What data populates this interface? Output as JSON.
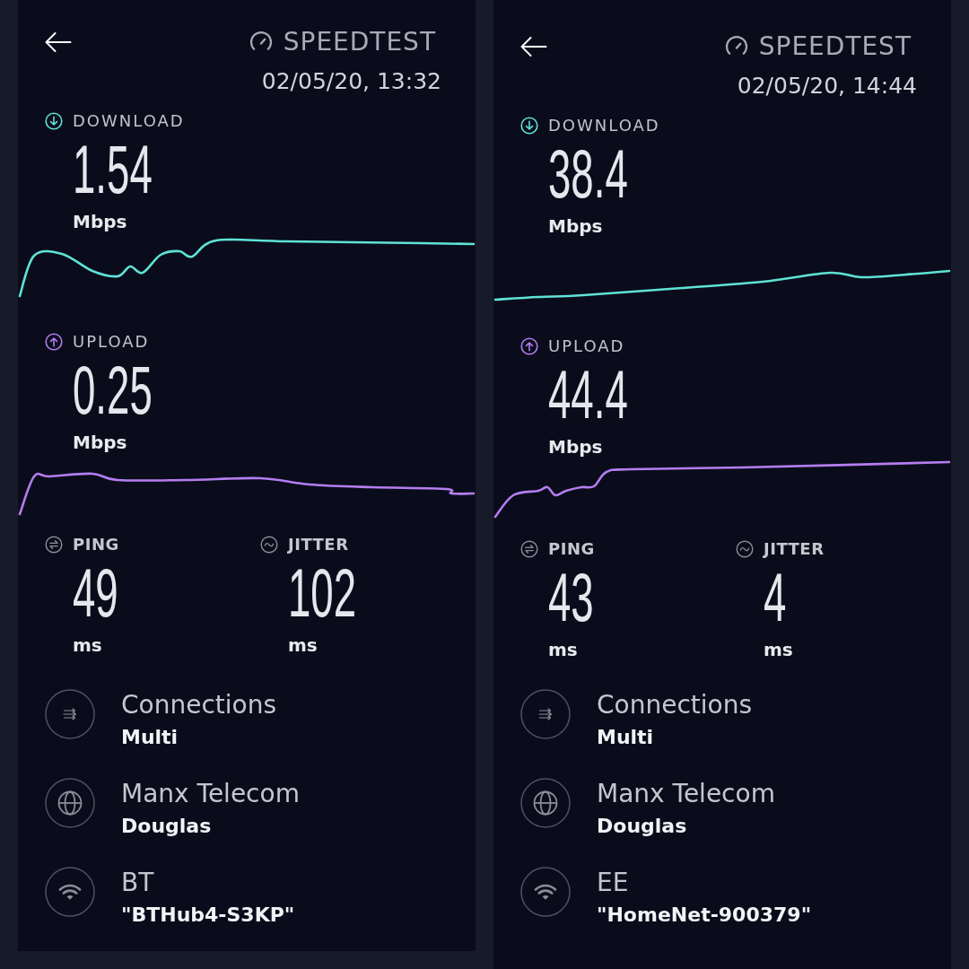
{
  "screens": [
    {
      "app_title": "SPEEDTEST",
      "timestamp": "02/05/20, 13:32",
      "speeds": [
        {
          "kind": "download",
          "label": "DOWNLOAD",
          "value": "1.54",
          "unit": "Mbps"
        },
        {
          "kind": "upload",
          "label": "UPLOAD",
          "value": "0.25",
          "unit": "Mbps"
        }
      ],
      "latency": [
        {
          "kind": "ping",
          "label": "PING",
          "value": "49",
          "unit": "ms"
        },
        {
          "kind": "jitter",
          "label": "JITTER",
          "value": "102",
          "unit": "ms"
        }
      ],
      "details": [
        {
          "kind": "connections",
          "title": "Connections",
          "value": "Multi"
        },
        {
          "kind": "server",
          "title": "Manx Telecom",
          "value": "Douglas"
        },
        {
          "kind": "network",
          "title": "BT",
          "value": "\"BTHub4-S3KP\""
        }
      ]
    },
    {
      "app_title": "SPEEDTEST",
      "timestamp": "02/05/20, 14:44",
      "speeds": [
        {
          "kind": "download",
          "label": "DOWNLOAD",
          "value": "38.4",
          "unit": "Mbps"
        },
        {
          "kind": "upload",
          "label": "UPLOAD",
          "value": "44.4",
          "unit": "Mbps"
        }
      ],
      "latency": [
        {
          "kind": "ping",
          "label": "PING",
          "value": "43",
          "unit": "ms"
        },
        {
          "kind": "jitter",
          "label": "JITTER",
          "value": "4",
          "unit": "ms"
        }
      ],
      "details": [
        {
          "kind": "connections",
          "title": "Connections",
          "value": "Multi"
        },
        {
          "kind": "server",
          "title": "Manx Telecom",
          "value": "Douglas"
        },
        {
          "kind": "network",
          "title": "EE",
          "value": "\"HomeNet-900379\""
        }
      ]
    }
  ]
}
